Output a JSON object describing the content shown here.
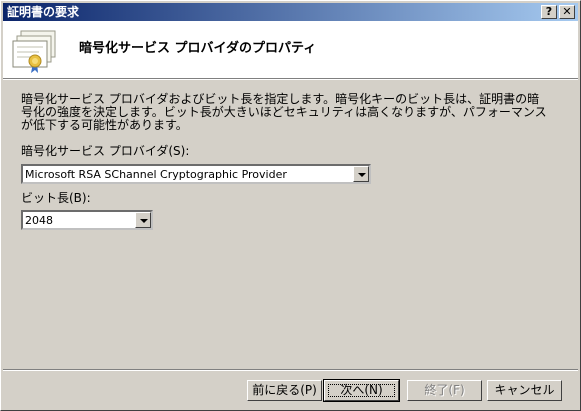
{
  "window": {
    "title": "証明書の要求",
    "help_glyph": "?",
    "close_glyph": "✕"
  },
  "header": {
    "title": "暗号化サービス プロバイダのプロパティ",
    "icon": "certificate-icon"
  },
  "body": {
    "description": "暗号化サービス プロバイダおよびビット長を指定します。暗号化キーのビット長は、証明書の暗号化の強度を決定します。ビット長が大きいほどセキュリティは高くなりますが、パフォーマンスが低下する可能性があります。",
    "csp_label": "暗号化サービス プロバイダ(S):",
    "csp_value": "Microsoft RSA SChannel Cryptographic Provider",
    "bitlen_label": "ビット長(B):",
    "bitlen_value": "2048"
  },
  "buttons": {
    "back": "前に戻る(P)",
    "next": "次へ(N)",
    "finish": "終了(F)",
    "cancel": "キャンセル"
  }
}
